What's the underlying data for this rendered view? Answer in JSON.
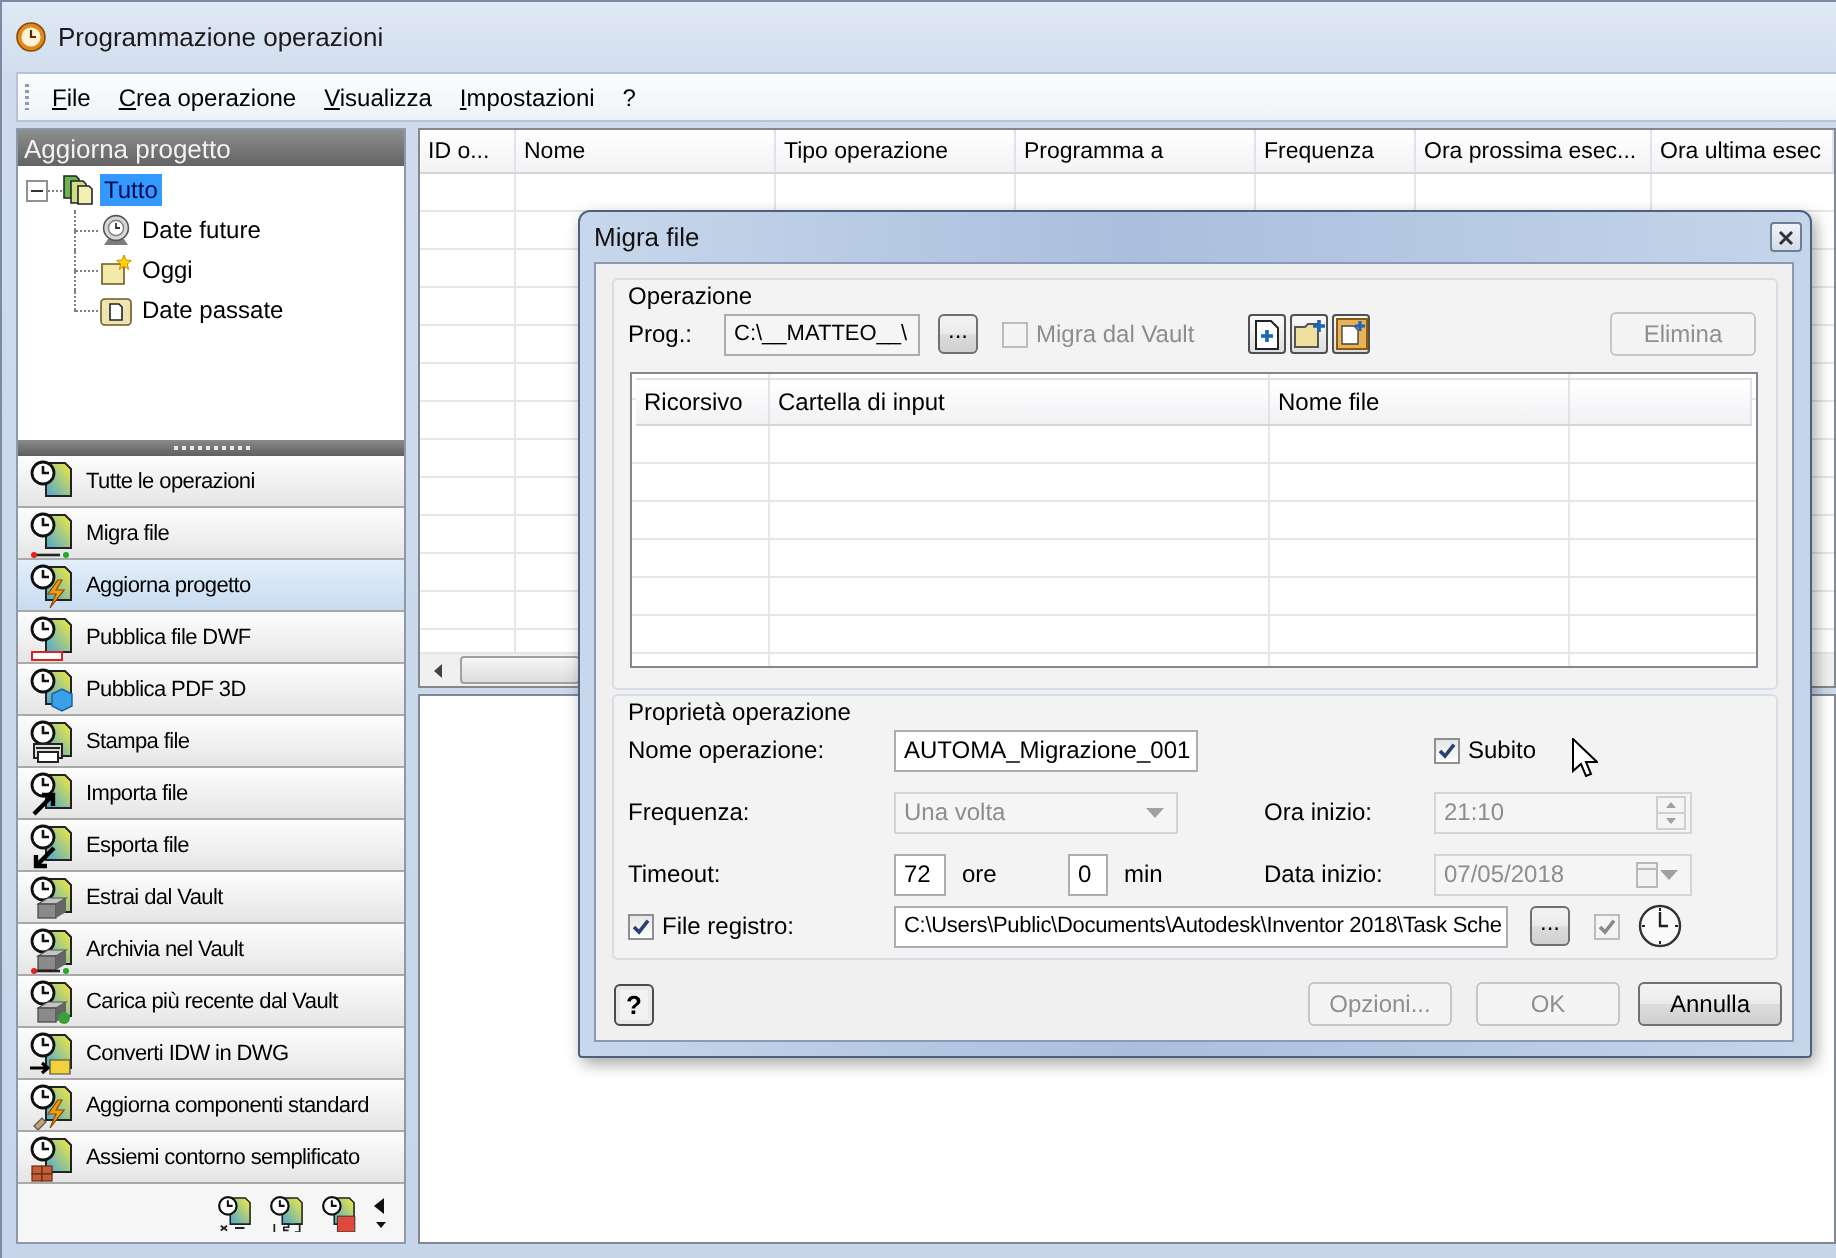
{
  "window": {
    "title": "Programmazione operazioni"
  },
  "menu": [
    "File",
    "Crea operazione",
    "Visualizza",
    "Impostazioni",
    "?"
  ],
  "sidebar": {
    "header": "Aggiorna progetto",
    "tree": [
      {
        "label": "Tutto",
        "selected": true,
        "expanded": true,
        "children": [
          {
            "label": "Date future",
            "selected": false
          },
          {
            "label": "Oggi",
            "selected": false
          },
          {
            "label": "Date passate",
            "selected": false
          }
        ]
      }
    ],
    "operations": [
      {
        "label": "Tutte le operazioni",
        "selected": false
      },
      {
        "label": "Migra file",
        "selected": false
      },
      {
        "label": "Aggiorna progetto",
        "selected": true
      },
      {
        "label": "Pubblica file DWF",
        "selected": false
      },
      {
        "label": "Pubblica PDF 3D",
        "selected": false
      },
      {
        "label": "Stampa file",
        "selected": false
      },
      {
        "label": "Importa file",
        "selected": false
      },
      {
        "label": "Esporta file",
        "selected": false
      },
      {
        "label": "Estrai dal Vault",
        "selected": false
      },
      {
        "label": "Archivia nel Vault",
        "selected": false
      },
      {
        "label": "Carica più recente dal Vault",
        "selected": false
      },
      {
        "label": "Converti IDW in DWG",
        "selected": false
      },
      {
        "label": "Aggiorna componenti standard",
        "selected": false
      },
      {
        "label": "Assiemi contorno semplificato",
        "selected": false
      }
    ]
  },
  "table": {
    "columns": [
      "ID o...",
      "Nome",
      "Tipo operazione",
      "Programma a",
      "Frequenza",
      "Ora prossima esec...",
      "Ora ultima esec"
    ]
  },
  "dialog": {
    "title": "Migra file",
    "operation": {
      "title": "Operazione",
      "program": {
        "label": "Prog.:",
        "value": "C:\\__MATTEO__\\"
      },
      "browse_button": "...",
      "vault": {
        "label": "Migra dal Vault",
        "checked": false,
        "disabled": true
      },
      "delete_button": {
        "label": "Elimina",
        "disabled": true
      },
      "columns": [
        "Ricorsivo",
        "Cartella di input",
        "Nome file"
      ]
    },
    "properties": {
      "title": "Proprietà operazione",
      "name": {
        "label": "Nome operazione:",
        "value": "AUTOMA_Migrazione_001"
      },
      "immediate": {
        "label": "Subito",
        "checked": true
      },
      "frequency": {
        "label": "Frequenza:",
        "value": "Una volta",
        "disabled": true
      },
      "start_time": {
        "label": "Ora inizio:",
        "value": "21:10",
        "disabled": true
      },
      "timeout": {
        "label": "Timeout:",
        "hours": "72",
        "hours_unit": "ore",
        "minutes": "0",
        "minutes_unit": "min"
      },
      "start_date": {
        "label": "Data inizio:",
        "value": "07/05/2018",
        "disabled": true
      },
      "log_file": {
        "label": "File registro:",
        "checked": true,
        "value": "C:\\Users\\Public\\Documents\\Autodesk\\Inventor 2018\\Task Sche",
        "browse_button": "...",
        "option": {
          "checked": true,
          "disabled": true
        }
      }
    },
    "help_button": "?",
    "buttons": [
      {
        "label": "Opzioni...",
        "disabled": true
      },
      {
        "label": "OK",
        "disabled": true
      },
      {
        "label": "Annulla",
        "disabled": false
      }
    ]
  }
}
